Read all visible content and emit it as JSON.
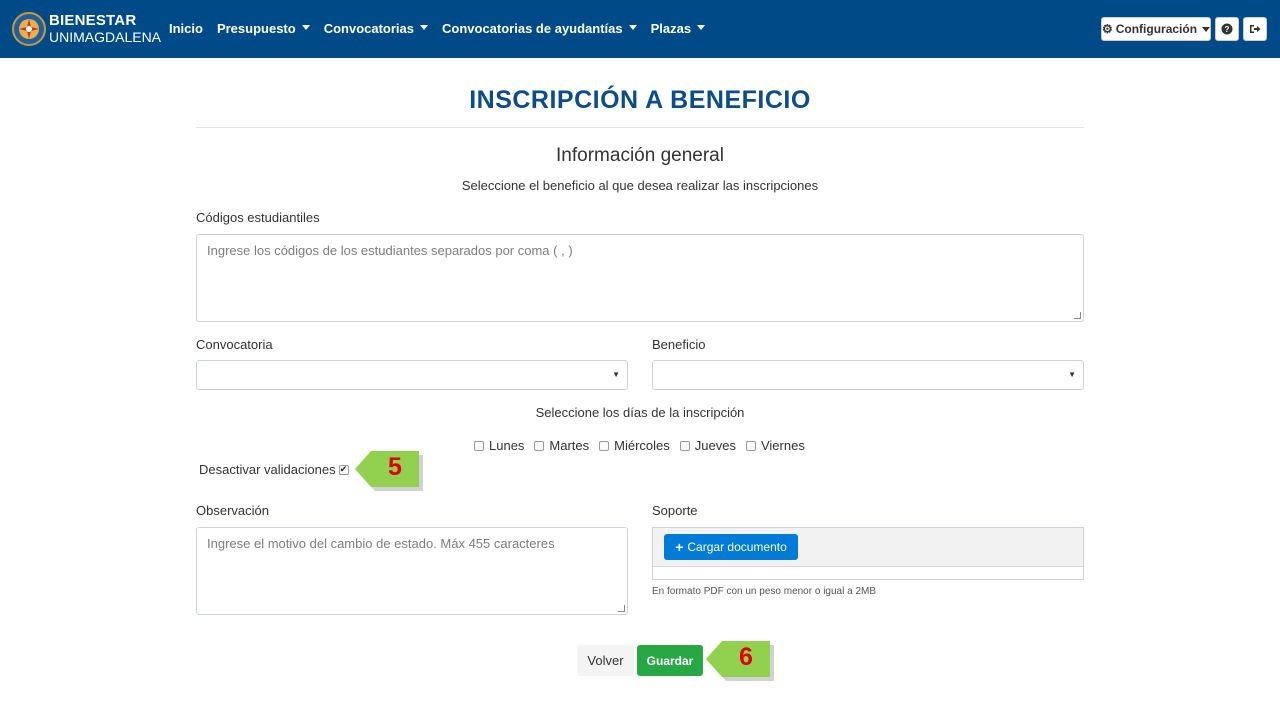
{
  "brand": {
    "line1": "BIENESTAR",
    "line2": "UNIMAGDALENA",
    "logo_icon": "university-seal-icon"
  },
  "nav": {
    "items": [
      {
        "label": "Inicio",
        "dropdown": false
      },
      {
        "label": "Presupuesto",
        "dropdown": true
      },
      {
        "label": "Convocatorias",
        "dropdown": true
      },
      {
        "label": "Convocatorias de ayudantías",
        "dropdown": true
      },
      {
        "label": "Plazas",
        "dropdown": true
      }
    ],
    "config_label": "Configuración",
    "config_icon": "gear-icon",
    "help_icon": "question-circle-icon",
    "logout_icon": "sign-out-icon"
  },
  "page": {
    "title": "INSCRIPCIÓN A BENEFICIO",
    "section_title": "Información general",
    "instructions": "Seleccione el beneficio al que desea realizar las inscripciones"
  },
  "form": {
    "codes_label": "Códigos estudiantiles",
    "codes_placeholder": "Ingrese los códigos de los estudiantes separados por coma ( , )",
    "convocatoria_label": "Convocatoria",
    "convocatoria_value": "",
    "beneficio_label": "Beneficio",
    "beneficio_value": "",
    "days_label": "Seleccione los días de la inscripción",
    "days": [
      {
        "label": "Lunes",
        "checked": false
      },
      {
        "label": "Martes",
        "checked": false
      },
      {
        "label": "Miércoles",
        "checked": false
      },
      {
        "label": "Jueves",
        "checked": false
      },
      {
        "label": "Viernes",
        "checked": false
      }
    ],
    "disable_validations_label": "Desactivar validaciones",
    "disable_validations_checked": true,
    "observacion_label": "Observación",
    "observacion_placeholder": "Ingrese el motivo del cambio de estado. Máx 455 caracteres",
    "soporte_label": "Soporte",
    "upload_button": "Cargar documento",
    "upload_hint": "En formato PDF con un peso menor o igual a 2MB"
  },
  "actions": {
    "back": "Volver",
    "save": "Guardar"
  },
  "callouts": {
    "first": "5",
    "second": "6",
    "color": "#92d050",
    "number_color": "#e00000"
  }
}
